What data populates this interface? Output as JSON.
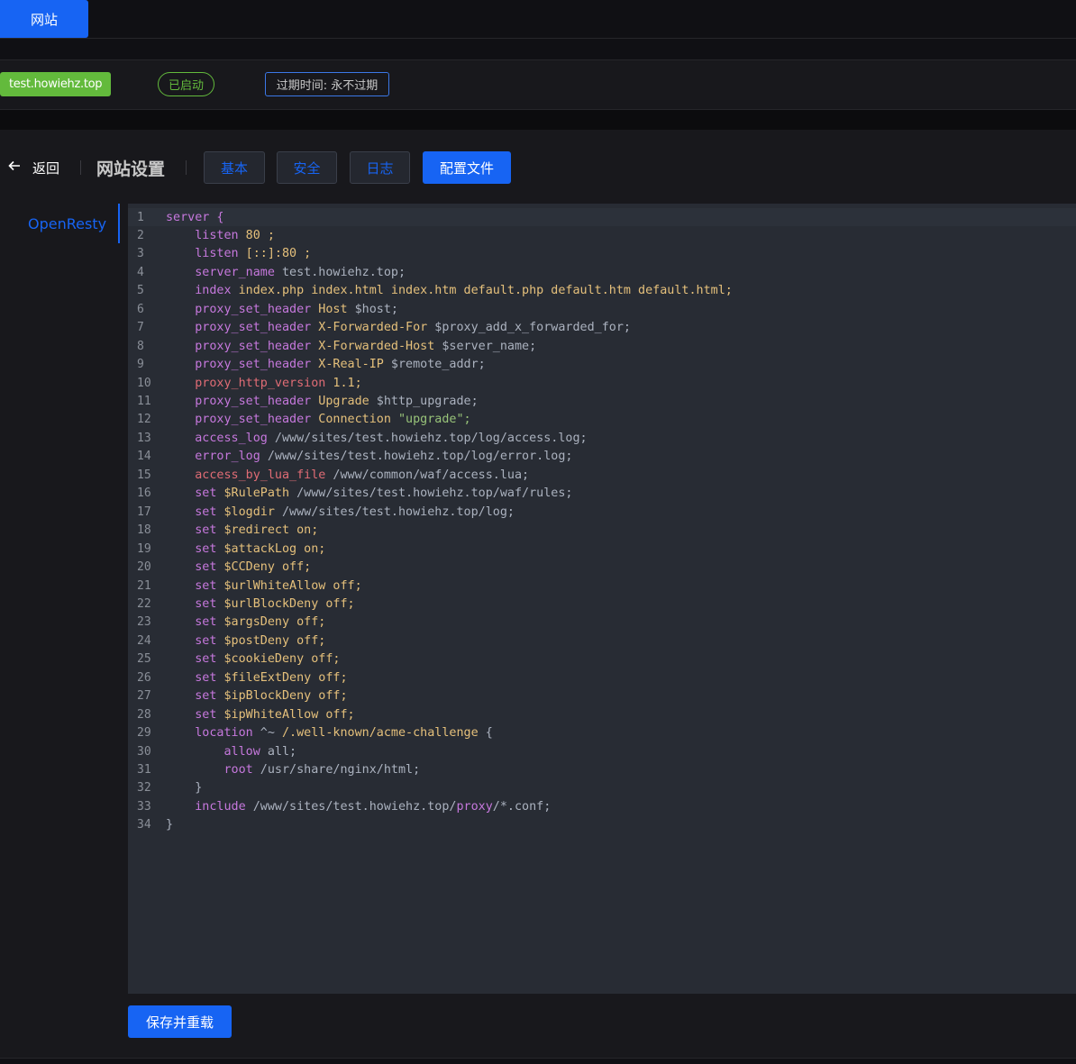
{
  "topbar": {
    "active_tab": "网站"
  },
  "site_info": {
    "domain": "test.howiehz.top",
    "status": "已启动",
    "expire": "过期时间: 永不过期"
  },
  "header": {
    "back_label": "返回",
    "title": "网站设置",
    "tabs": [
      {
        "label": "基本"
      },
      {
        "label": "安全"
      },
      {
        "label": "日志"
      },
      {
        "label": "配置文件",
        "active": true
      }
    ]
  },
  "side_menu": {
    "items": [
      {
        "label": "OpenResty"
      }
    ]
  },
  "editor": {
    "lines": [
      [
        [
          "server {",
          "k"
        ]
      ],
      [
        [
          "    listen",
          "k"
        ],
        [
          " 80 ;",
          "y"
        ]
      ],
      [
        [
          "    listen",
          "k"
        ],
        [
          " [::]:80 ;",
          "y"
        ]
      ],
      [
        [
          "    server_name",
          "k"
        ],
        [
          " test.howiehz.top;",
          "t"
        ]
      ],
      [
        [
          "    index",
          "k"
        ],
        [
          " index.php index.html index.htm default.php default.htm default.html;",
          "y"
        ]
      ],
      [
        [
          "    proxy_set_header",
          "k"
        ],
        [
          " Host",
          "y"
        ],
        [
          " $host;",
          "t"
        ]
      ],
      [
        [
          "    proxy_set_header",
          "k"
        ],
        [
          " X-Forwarded-For",
          "y"
        ],
        [
          " $proxy_add_x_forwarded_for;",
          "t"
        ]
      ],
      [
        [
          "    proxy_set_header",
          "k"
        ],
        [
          " X-Forwarded-Host",
          "y"
        ],
        [
          " $server_name;",
          "t"
        ]
      ],
      [
        [
          "    proxy_set_header",
          "k"
        ],
        [
          " X-Real-IP",
          "y"
        ],
        [
          " $remote_addr;",
          "t"
        ]
      ],
      [
        [
          "    proxy_http_version",
          "r"
        ],
        [
          " 1.1;",
          "y"
        ]
      ],
      [
        [
          "    proxy_set_header",
          "k"
        ],
        [
          " Upgrade",
          "y"
        ],
        [
          " $http_upgrade;",
          "t"
        ]
      ],
      [
        [
          "    proxy_set_header",
          "k"
        ],
        [
          " Connection",
          "y"
        ],
        [
          " \"upgrade\";",
          "s"
        ]
      ],
      [
        [
          "    access_log",
          "k"
        ],
        [
          " /www/sites/test.howiehz.top/log/access.log;",
          "t"
        ]
      ],
      [
        [
          "    error_log",
          "k"
        ],
        [
          " /www/sites/test.howiehz.top/log/error.log;",
          "t"
        ]
      ],
      [
        [
          "    access_by_lua_file",
          "r"
        ],
        [
          " /www/common/waf/access.lua;",
          "t"
        ]
      ],
      [
        [
          "    set",
          "k"
        ],
        [
          " $RulePath",
          "y"
        ],
        [
          " /www/sites/test.howiehz.top/waf/rules;",
          "t"
        ]
      ],
      [
        [
          "    set",
          "k"
        ],
        [
          " $logdir",
          "y"
        ],
        [
          " /www/sites/test.howiehz.top/log;",
          "t"
        ]
      ],
      [
        [
          "    set",
          "k"
        ],
        [
          " $redirect",
          "y"
        ],
        [
          " on;",
          "y"
        ]
      ],
      [
        [
          "    set",
          "k"
        ],
        [
          " $attackLog",
          "y"
        ],
        [
          " on;",
          "y"
        ]
      ],
      [
        [
          "    set",
          "k"
        ],
        [
          " $CCDeny",
          "y"
        ],
        [
          " off;",
          "y"
        ]
      ],
      [
        [
          "    set",
          "k"
        ],
        [
          " $urlWhiteAllow",
          "y"
        ],
        [
          " off;",
          "y"
        ]
      ],
      [
        [
          "    set",
          "k"
        ],
        [
          " $urlBlockDeny",
          "y"
        ],
        [
          " off;",
          "y"
        ]
      ],
      [
        [
          "    set",
          "k"
        ],
        [
          " $argsDeny",
          "y"
        ],
        [
          " off;",
          "y"
        ]
      ],
      [
        [
          "    set",
          "k"
        ],
        [
          " $postDeny",
          "y"
        ],
        [
          " off;",
          "y"
        ]
      ],
      [
        [
          "    set",
          "k"
        ],
        [
          " $cookieDeny",
          "y"
        ],
        [
          " off;",
          "y"
        ]
      ],
      [
        [
          "    set",
          "k"
        ],
        [
          " $fileExtDeny",
          "y"
        ],
        [
          " off;",
          "y"
        ]
      ],
      [
        [
          "    set",
          "k"
        ],
        [
          " $ipBlockDeny",
          "y"
        ],
        [
          " off;",
          "y"
        ]
      ],
      [
        [
          "    set",
          "k"
        ],
        [
          " $ipWhiteAllow",
          "y"
        ],
        [
          " off;",
          "y"
        ]
      ],
      [
        [
          "    location",
          "k"
        ],
        [
          " ^~",
          "t"
        ],
        [
          " /.well-known/acme-challenge",
          "y"
        ],
        [
          " {",
          "t"
        ]
      ],
      [
        [
          "        allow",
          "k"
        ],
        [
          " all;",
          "t"
        ]
      ],
      [
        [
          "        root",
          "k"
        ],
        [
          " /usr/share/nginx/html;",
          "t"
        ]
      ],
      [
        [
          "    }",
          "t"
        ]
      ],
      [
        [
          "    include",
          "k"
        ],
        [
          " /www/sites/test.howiehz.top/",
          "t"
        ],
        [
          "proxy",
          "k"
        ],
        [
          "/*.conf;",
          "t"
        ]
      ],
      [
        [
          "}",
          "t"
        ]
      ]
    ]
  },
  "actions": {
    "save_label": "保存并重载"
  },
  "colors": {
    "accent": "#1764f3",
    "success": "#63ba3c",
    "editor_bg": "#282c34"
  }
}
